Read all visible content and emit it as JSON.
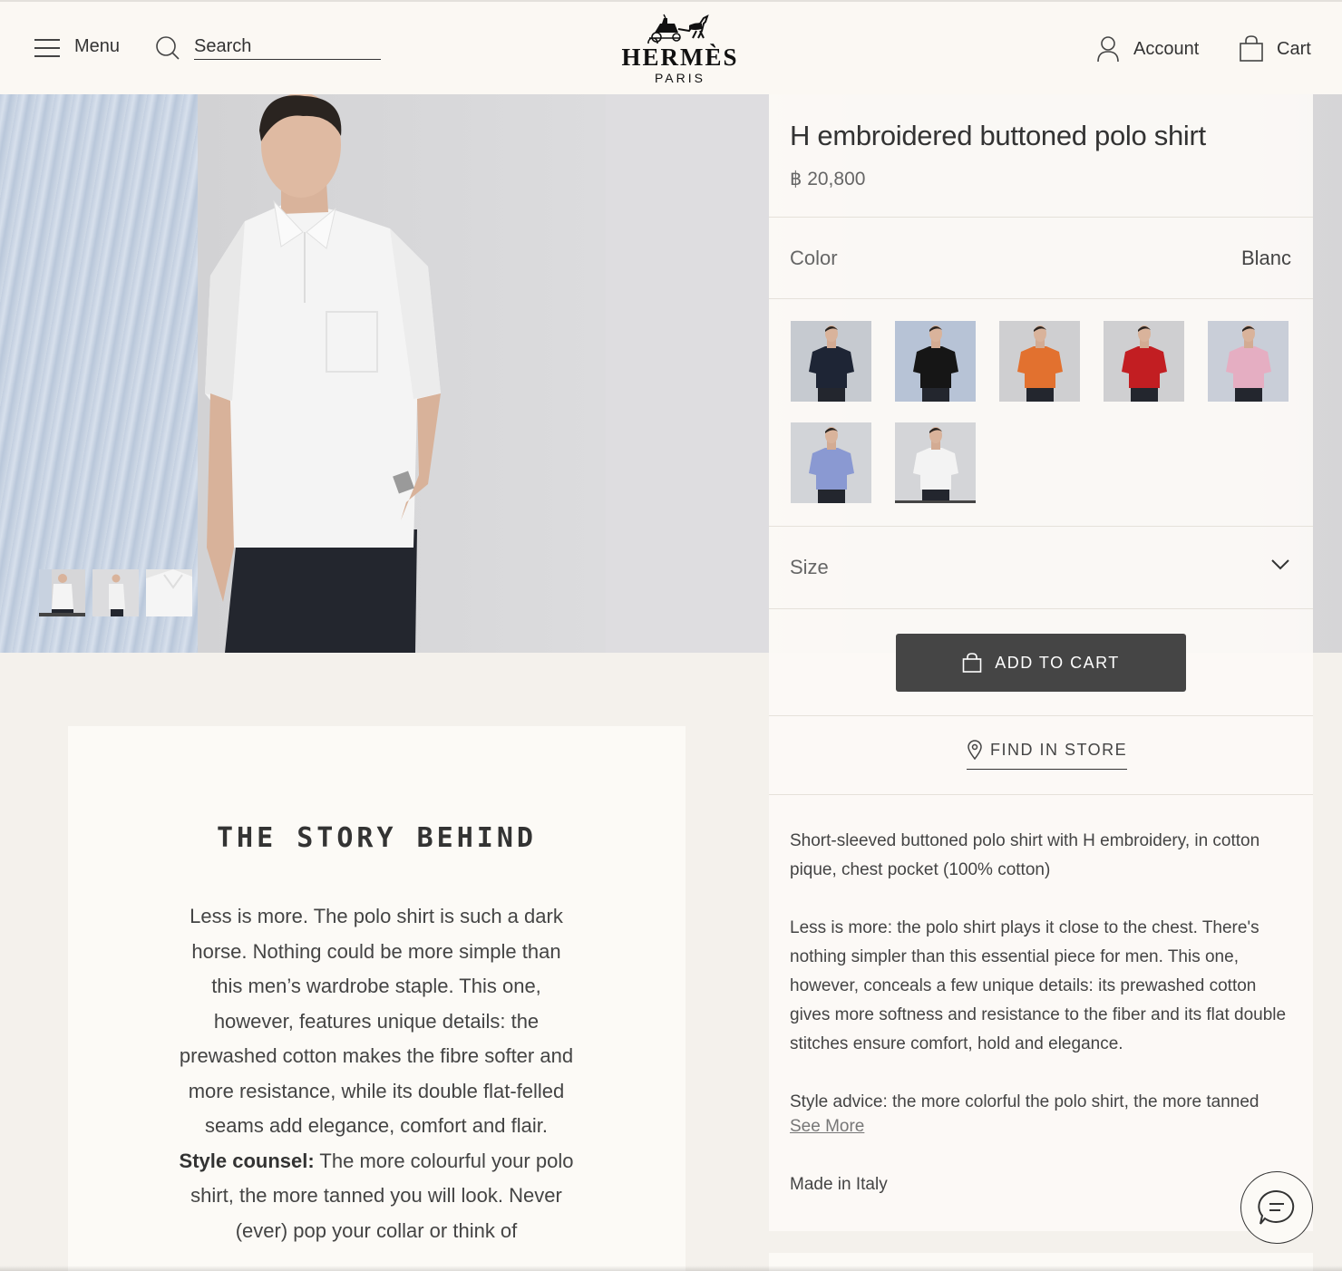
{
  "header": {
    "menu_label": "Menu",
    "search_placeholder": "Search",
    "logo_word": "HERMÈS",
    "logo_sub": "PARIS",
    "account_label": "Account",
    "cart_label": "Cart"
  },
  "gallery": {
    "thumbnails": [
      "front view",
      "side view",
      "detail view"
    ],
    "active_thumbnail": 0
  },
  "product": {
    "title": "H embroidered buttoned polo shirt",
    "price": "฿ 20,800",
    "color_label": "Color",
    "color_value": "Blanc",
    "swatches": [
      {
        "name": "navy",
        "shirt": "#1e2535"
      },
      {
        "name": "black",
        "shirt": "#161616"
      },
      {
        "name": "orange",
        "shirt": "#e2712f"
      },
      {
        "name": "red",
        "shirt": "#c21e22"
      },
      {
        "name": "pink",
        "shirt": "#e5aec2"
      },
      {
        "name": "blue",
        "shirt": "#8a99d2"
      },
      {
        "name": "white",
        "shirt": "#f3f3f3"
      }
    ],
    "selected_swatch": 6,
    "size_label": "Size",
    "add_to_cart": "ADD TO CART",
    "find_in_store": "FIND IN STORE",
    "description": [
      "Short-sleeved buttoned polo shirt with H embroidery, in cotton pique, chest pocket (100% cotton)",
      "Less is more: the polo shirt plays it close to the chest. There's nothing simpler than this essential piece for men. This one, however, conceals a few unique details: its prewashed cotton gives more softness and resistance to the fiber and its flat double stitches ensure comfort, hold and elegance.",
      "Style advice: the more colorful the polo shirt, the more tanned"
    ],
    "see_more": "See More",
    "made_in": "Made in Italy"
  },
  "story": {
    "title": "THE STORY BEHIND",
    "body": "Less is more. The polo shirt is such a dark horse. Nothing could be more simple than this men’s wardrobe staple. This one, however, features unique details: the prewashed cotton makes the fibre softer and more resistance, while its double flat-felled seams add elegance, comfort and flair.",
    "counsel_label": "Style counsel:",
    "counsel_text": " The more colourful your polo shirt, the more tanned you will look. Never (ever) pop your collar or think of"
  },
  "colors": {
    "background": "#f4f1ec",
    "panel": "#fcfaf6",
    "button": "#454545",
    "text": "#444444"
  }
}
